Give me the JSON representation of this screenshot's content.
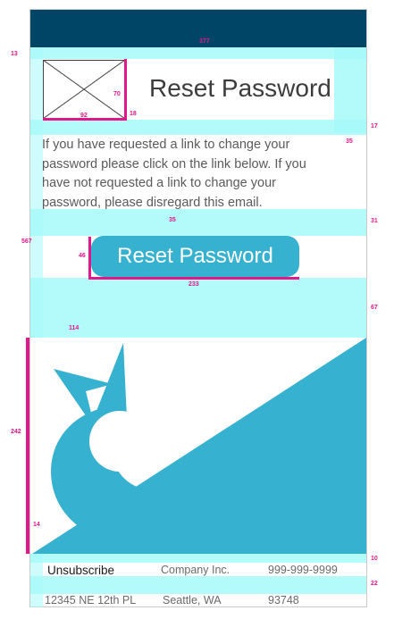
{
  "title": "Reset Password",
  "body_text": "If you have requested a link to change your password please click on the link below. If you have not requested a link to change your password, please disregard this email.",
  "cta_label": "Reset Password",
  "footer": {
    "unsubscribe": "Unsubscribe",
    "company": "Company Inc.",
    "phone": "999-999-9999",
    "address": "12345 NE 12th PL",
    "city": "Seattle, WA",
    "zip": "93748"
  },
  "annotations": {
    "a377": "377",
    "a13": "13",
    "a70": "70",
    "a92": "92",
    "a18": "18",
    "a17": "17",
    "a35a": "35",
    "a35b": "35",
    "a31": "31",
    "a567": "567",
    "a46": "46",
    "a233": "233",
    "a67": "67",
    "a114": "114",
    "a242": "242",
    "a14": "14",
    "a10": "10",
    "a22": "22"
  },
  "colors": {
    "header": "#004566",
    "accent": "#36b1cf",
    "annotation": "#e0188c",
    "spacing": "#a6f9f9"
  }
}
